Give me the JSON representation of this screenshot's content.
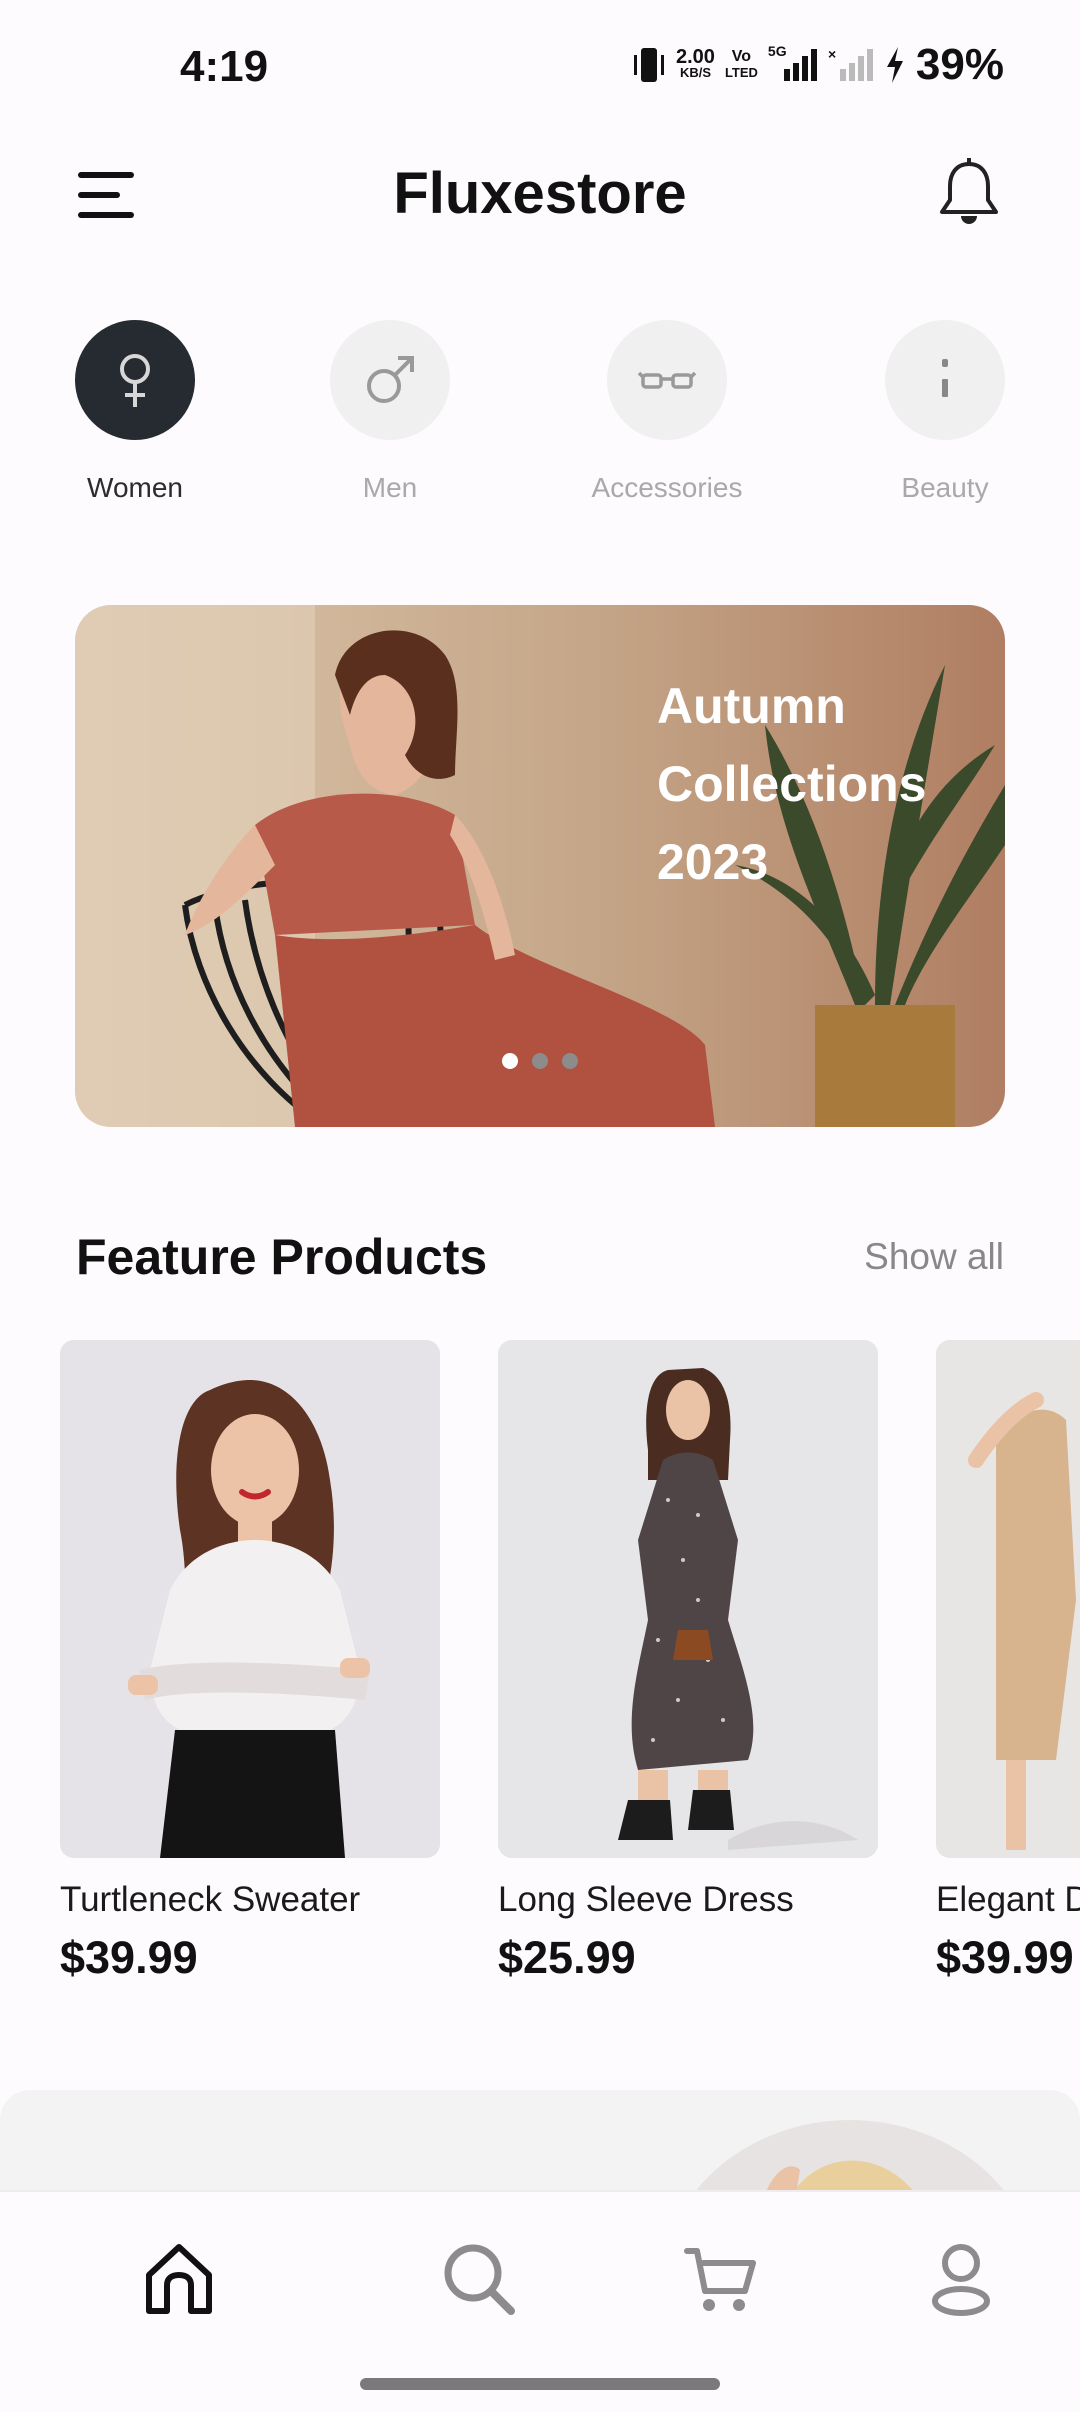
{
  "status_bar": {
    "time": "4:19",
    "speed_value": "2.00",
    "speed_unit": "KB/S",
    "volte_line1": "Vo",
    "volte_line2": "LTED",
    "network": "5G",
    "battery": "39%"
  },
  "header": {
    "title": "Fluxestore",
    "menu_icon": "hamburger-menu-icon",
    "bell_icon": "bell-icon"
  },
  "categories": [
    {
      "label": "Women",
      "icon": "female-icon",
      "active": true
    },
    {
      "label": "Men",
      "icon": "male-icon",
      "active": false
    },
    {
      "label": "Accessories",
      "icon": "glasses-icon",
      "active": false
    },
    {
      "label": "Beauty",
      "icon": "lipstick-icon",
      "active": false
    }
  ],
  "banner": {
    "line1": "Autumn",
    "line2": "Collections",
    "line3": "2023",
    "pages": 3,
    "current_page": 1
  },
  "featured": {
    "title": "Feature Products",
    "show_all": "Show all",
    "products": [
      {
        "name": "Turtleneck Sweater",
        "price": "$39.99"
      },
      {
        "name": "Long Sleeve Dress",
        "price": "$25.99"
      },
      {
        "name": "Elegant D",
        "price": "$39.99"
      }
    ]
  },
  "bottom_nav": [
    {
      "icon": "home-icon",
      "active": true
    },
    {
      "icon": "search-icon",
      "active": false
    },
    {
      "icon": "cart-icon",
      "active": false
    },
    {
      "icon": "profile-icon",
      "active": false
    }
  ],
  "colors": {
    "active_category": "#262a31",
    "inactive_category": "#f1f0f1",
    "background": "#fdfbfd"
  }
}
